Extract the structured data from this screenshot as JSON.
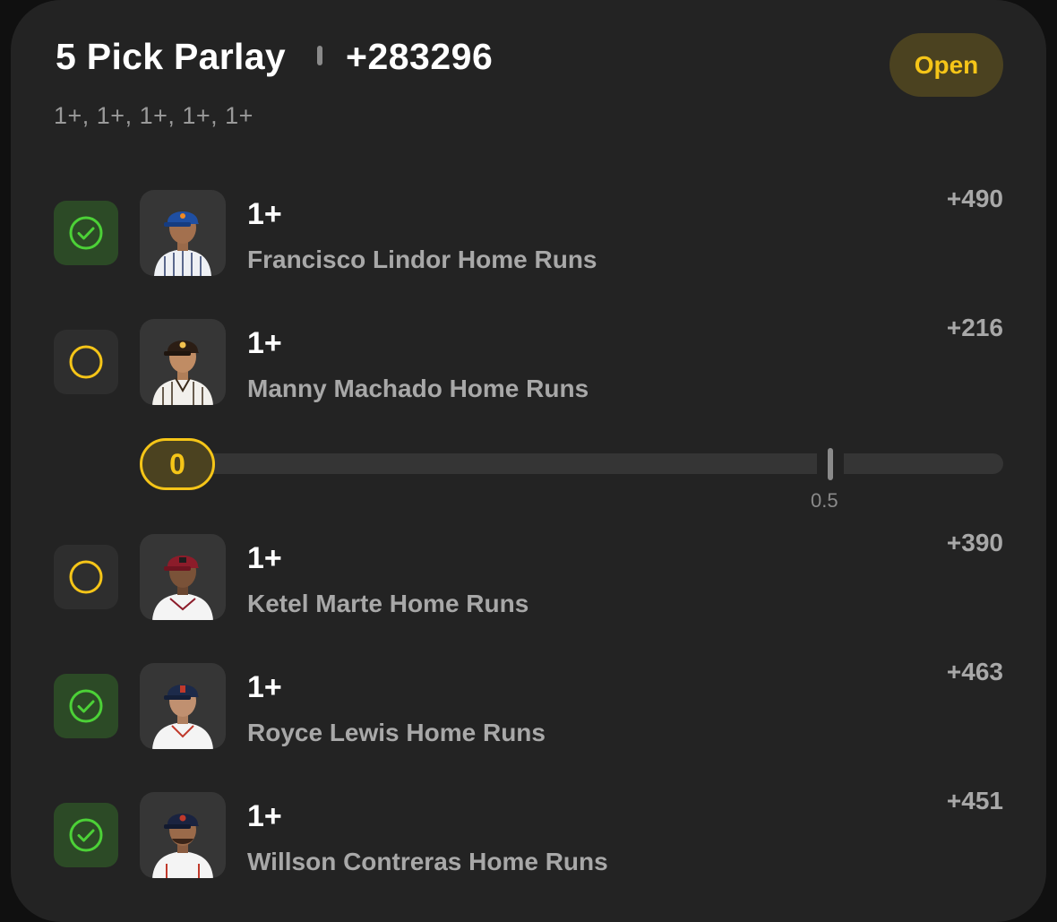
{
  "header": {
    "title": "5 Pick Parlay",
    "total_odds": "+283296",
    "status": "Open",
    "subtitle": "1+, 1+, 1+, 1+, 1+"
  },
  "colors": {
    "card_bg": "#232323",
    "accent_yellow": "#f5c518",
    "win_green": "#4cd137",
    "muted_text": "#a8a8a8"
  },
  "picks": [
    {
      "line": "1+",
      "market": "Francisco Lindor Home Runs",
      "odds": "+490",
      "status": "won",
      "icon": "check-circle-icon",
      "cap_color": "#1f4fa3",
      "jersey": "pinstripe-white"
    },
    {
      "line": "1+",
      "market": "Manny Machado Home Runs",
      "odds": "+216",
      "status": "pending",
      "icon": "empty-circle-icon",
      "cap_color": "#2b1d14",
      "jersey": "pinstripe-white"
    },
    {
      "line": "1+",
      "market": "Ketel Marte Home Runs",
      "odds": "+390",
      "status": "pending",
      "icon": "empty-circle-icon",
      "cap_color": "#8c1c2a",
      "jersey": "white"
    },
    {
      "line": "1+",
      "market": "Royce Lewis Home Runs",
      "odds": "+463",
      "status": "won",
      "icon": "check-circle-icon",
      "cap_color": "#1c2a4a",
      "jersey": "white"
    },
    {
      "line": "1+",
      "market": "Willson Contreras Home Runs",
      "odds": "+451",
      "status": "won",
      "icon": "check-circle-icon",
      "cap_color": "#1a2340",
      "jersey": "white"
    }
  ],
  "progress": {
    "current": "0",
    "target": "0.5"
  }
}
